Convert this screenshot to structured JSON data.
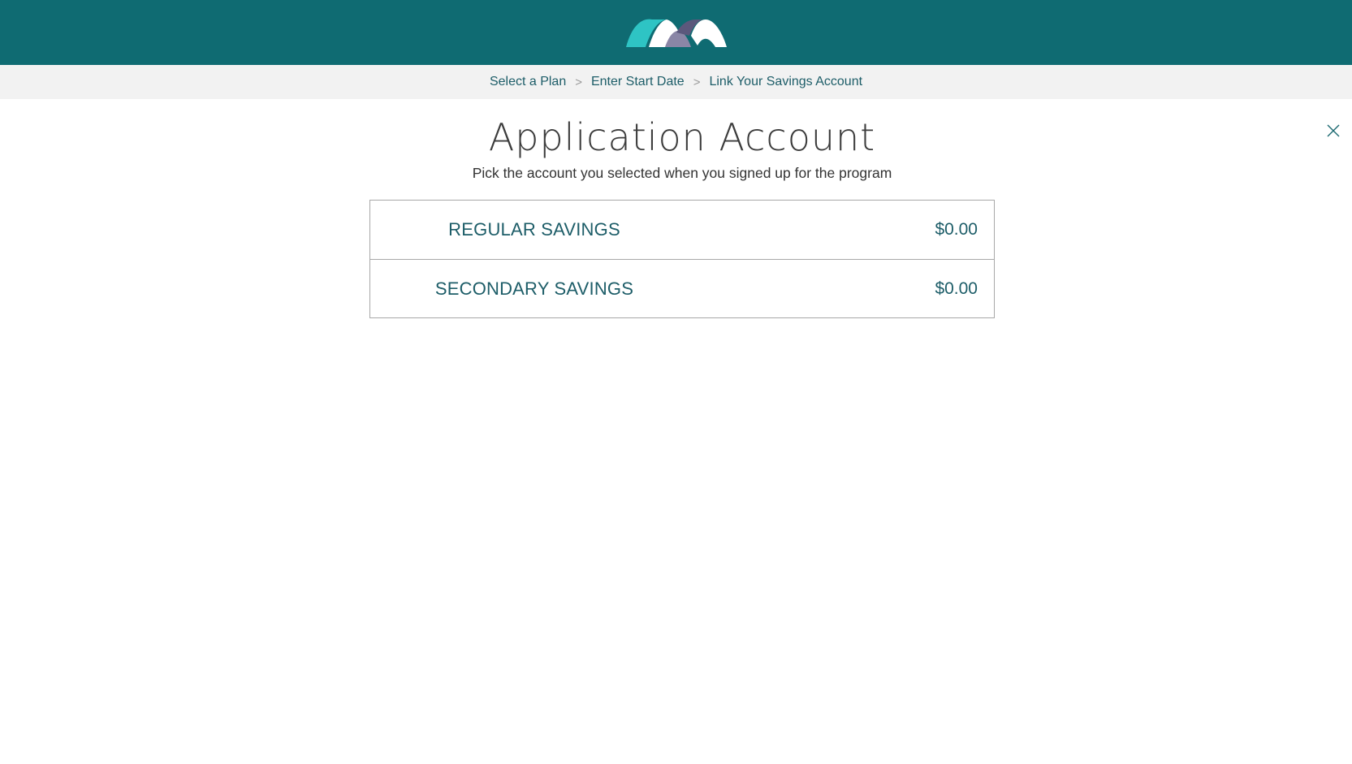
{
  "header": {
    "logo_icon": "brand-logo-arches",
    "colors": {
      "bar": "#0f6b72",
      "logo_teal": "#2ec4c4",
      "logo_purple_light": "#8a86a6",
      "logo_purple_dark": "#5b587c",
      "logo_white": "#ffffff"
    }
  },
  "breadcrumb": {
    "items": [
      {
        "label": "Select a Plan"
      },
      {
        "label": "Enter Start Date"
      },
      {
        "label": "Link Your Savings Account"
      }
    ],
    "separator": ">"
  },
  "close_icon": "close-icon",
  "main": {
    "title": "Application Account",
    "subtitle": "Pick the account you selected when you signed up for the program",
    "accounts": [
      {
        "name": "REGULAR SAVINGS",
        "balance": "$0.00"
      },
      {
        "name": "SECONDARY SAVINGS",
        "balance": "$0.00"
      }
    ]
  }
}
